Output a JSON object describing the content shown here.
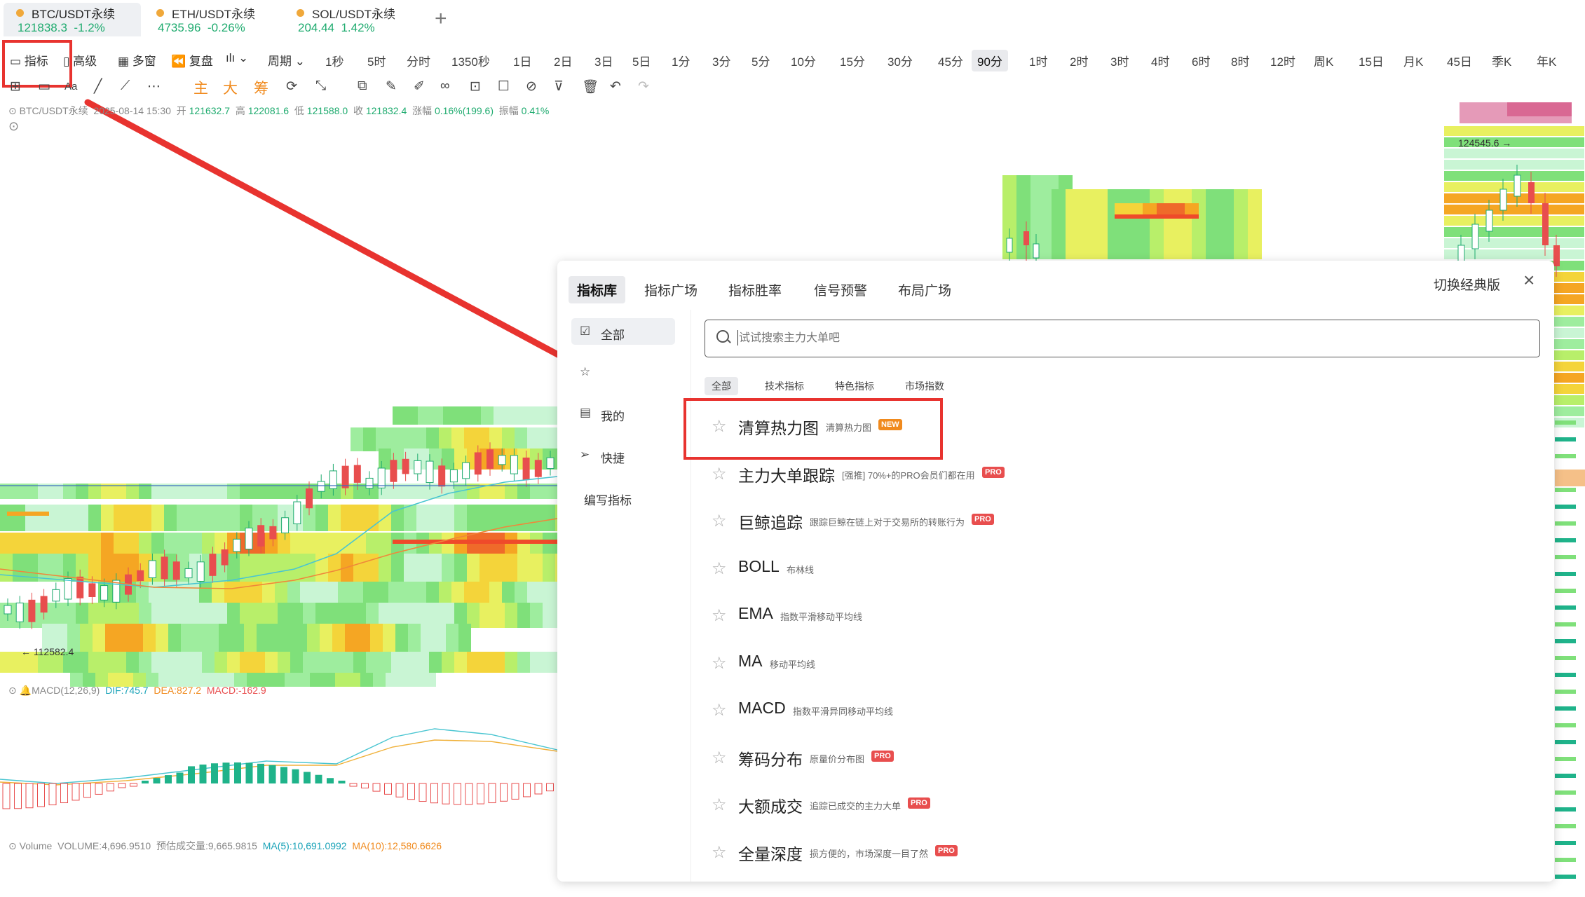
{
  "tickers": [
    {
      "name": "BTC/USDT永续",
      "price": "121838.3",
      "change": "-1.2%"
    },
    {
      "name": "ETH/USDT永续",
      "price": "4735.96",
      "change": "-0.26%"
    },
    {
      "name": "SOL/USDT永续",
      "price": "204.44",
      "change": "1.42%"
    }
  ],
  "add_tab": "+",
  "toolbar": {
    "indicator": "指标",
    "advanced": "高级",
    "multi": "多窗",
    "replay": "复盘",
    "period": "周期",
    "periods": [
      "1秒",
      "5时",
      "分时",
      "1350秒",
      "1日",
      "2日",
      "3日",
      "5日",
      "1分",
      "3分",
      "5分",
      "10分",
      "15分",
      "30分",
      "45分",
      "90分",
      "1时",
      "2时",
      "3时",
      "4时",
      "6时",
      "8时",
      "12时",
      "周K",
      "15日",
      "月K",
      "45日",
      "季K",
      "年K"
    ],
    "active_period": "90分"
  },
  "draw_tools": {
    "zhu": "主",
    "da": "大",
    "chou": "筹",
    "text_tool": "Aa"
  },
  "info_line": {
    "symbol": "BTC/USDT永续",
    "datetime": "2025-08-14 15:30",
    "open_label": "开",
    "open": "121632.7",
    "high_label": "高",
    "high": "122081.6",
    "low_label": "低",
    "low": "121588.0",
    "close_label": "收",
    "close": "121832.4",
    "chg_label": "涨幅",
    "chg": "0.16%(199.6)",
    "amp_label": "振幅",
    "amp": "0.41%"
  },
  "price_labels": {
    "high": "124545.6",
    "low": "112582.4"
  },
  "macd_line": {
    "name": "MACD(12,26,9)",
    "dif": "DIF:745.7",
    "dea": "DEA:827.2",
    "macd": "MACD:-162.9"
  },
  "volume_line": {
    "name": "Volume",
    "volume": "VOLUME:4,696.9510",
    "est": "预估成交量:9,665.9815",
    "ma5": "MA(5):10,691.0992",
    "ma10": "MA(10):12,580.6626"
  },
  "panel": {
    "tabs": [
      "指标库",
      "指标广场",
      "指标胜率",
      "信号预警",
      "布局广场"
    ],
    "classic": "切换经典版",
    "close": "×",
    "side_items": [
      "全部",
      "我的",
      "快捷",
      "编写指标"
    ],
    "search_placeholder": "试试搜索主力大单吧",
    "filters": [
      "全部",
      "技术指标",
      "特色指标",
      "市场指数"
    ],
    "indicators": [
      {
        "title": "清算热力图",
        "desc": "清算热力图",
        "badge": "NEW"
      },
      {
        "title": "主力大单跟踪",
        "desc": "[强推] 70%+的PRO会员们都在用",
        "badge": "PRO"
      },
      {
        "title": "巨鲸追踪",
        "desc": "跟踪巨鲸在链上对于交易所的转账行为",
        "badge": "PRO"
      },
      {
        "title": "BOLL",
        "desc": "布林线",
        "badge": ""
      },
      {
        "title": "EMA",
        "desc": "指数平滑移动平均线",
        "badge": ""
      },
      {
        "title": "MA",
        "desc": "移动平均线",
        "badge": ""
      },
      {
        "title": "MACD",
        "desc": "指数平滑异同移动平均线",
        "badge": ""
      },
      {
        "title": "筹码分布",
        "desc": "原量价分布图",
        "badge": "PRO"
      },
      {
        "title": "大额成交",
        "desc": "追踪已成交的主力大单",
        "badge": "PRO"
      },
      {
        "title": "全量深度",
        "desc": "损方便的，市场深度一目了然",
        "badge": "PRO"
      }
    ]
  },
  "colors": {
    "accent_red": "#e8332f",
    "up_green": "#1fab6f",
    "down_red": "#e84e4e",
    "macd_bar_green": "#1fb38a"
  }
}
